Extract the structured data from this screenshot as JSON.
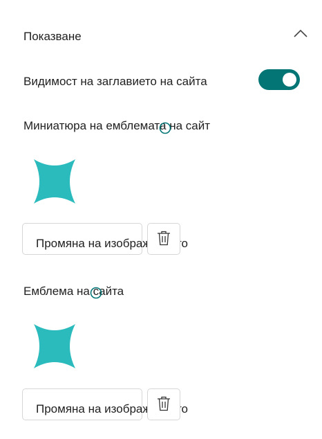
{
  "section": {
    "title": "Показване"
  },
  "toggle": {
    "label": "Видимост на заглавието на сайта",
    "state": "on",
    "color": "#037575"
  },
  "thumbnail": {
    "label": "Миниатюра на емблемата на сайт",
    "change_label": "Промяна на изображението"
  },
  "logo": {
    "label": "Емблема на сайта",
    "change_label": "Промяна на изображението"
  },
  "colors": {
    "logo": "#2bbbbd",
    "info_icon": "#037575"
  }
}
